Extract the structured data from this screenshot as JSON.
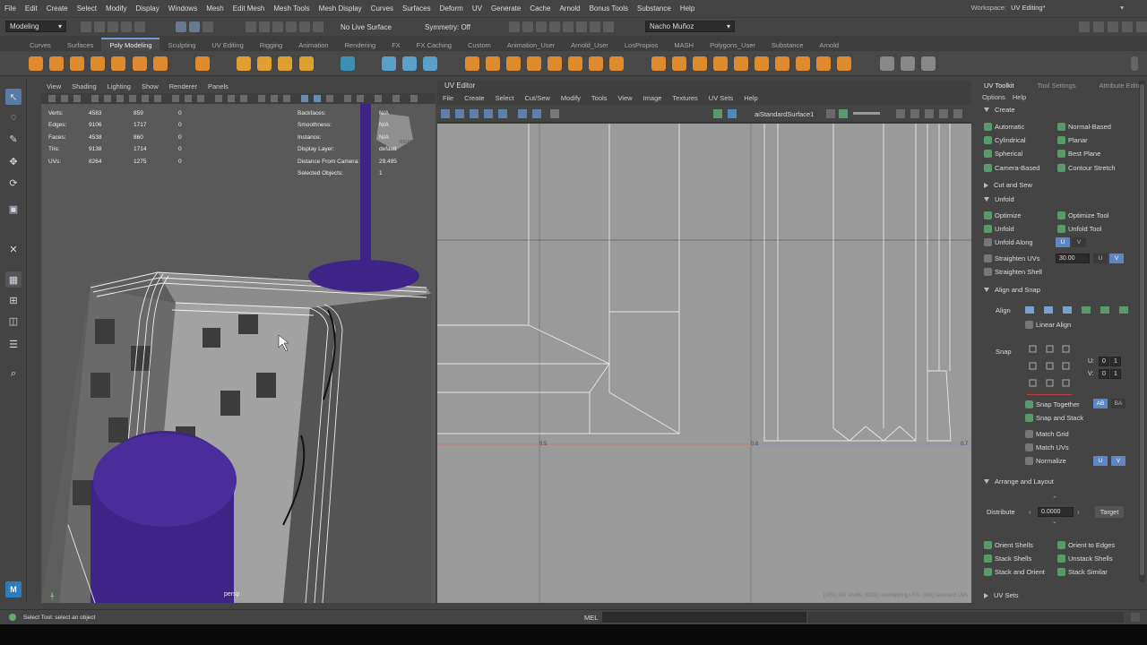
{
  "menubar": {
    "items": [
      "File",
      "Edit",
      "Create",
      "Select",
      "Modify",
      "Display",
      "Windows",
      "Mesh",
      "Edit Mesh",
      "Mesh Tools",
      "Mesh Display",
      "Curves",
      "Surfaces",
      "Deform",
      "UV",
      "Generate",
      "Cache",
      "Arnold",
      "Bonus Tools",
      "Substance",
      "Help"
    ],
    "workspace_label": "Workspace:",
    "workspace_value": "UV Editing*"
  },
  "statusline": {
    "mode": "Modeling",
    "live_surface": "No Live Surface",
    "symmetry": "Symmetry: Off",
    "user": "Nacho Muñoz"
  },
  "shelf": {
    "tabs": [
      "Curves",
      "Surfaces",
      "Poly Modeling",
      "Sculpting",
      "UV Editing",
      "Rigging",
      "Animation",
      "Rendering",
      "FX",
      "FX Caching",
      "Custom",
      "Animation_User",
      "Arnold_User",
      "LosPropios",
      "MASH",
      "Polygons_User",
      "Substance",
      "Arnold"
    ],
    "active_tab": "Poly Modeling"
  },
  "viewport": {
    "menu": [
      "View",
      "Shading",
      "Lighting",
      "Show",
      "Renderer",
      "Panels"
    ],
    "hud_left": [
      {
        "label": "Verts:",
        "a": "4583",
        "b": "859",
        "c": "0"
      },
      {
        "label": "Edges:",
        "a": "9106",
        "b": "1717",
        "c": "0"
      },
      {
        "label": "Faces:",
        "a": "4538",
        "b": "860",
        "c": "0"
      },
      {
        "label": "Tris:",
        "a": "9138",
        "b": "1714",
        "c": "0"
      },
      {
        "label": "UVs:",
        "a": "8264",
        "b": "1275",
        "c": "0"
      }
    ],
    "hud_right": [
      {
        "label": "Backfaces:",
        "value": "N/A"
      },
      {
        "label": "Smoothness:",
        "value": "N/A"
      },
      {
        "label": "Instance:",
        "value": "N/A"
      },
      {
        "label": "Display Layer:",
        "value": "default"
      },
      {
        "label": "Distance From Camera:",
        "value": "29.495"
      },
      {
        "label": "Selected Objects:",
        "value": "1"
      }
    ],
    "camera_label": "persp",
    "viewcube_label": "RIGHT"
  },
  "uv_editor": {
    "title": "UV Editor",
    "menu": [
      "File",
      "Create",
      "Select",
      "Cut/Sew",
      "Modify",
      "Tools",
      "View",
      "Image",
      "Textures",
      "UV Sets",
      "Help"
    ],
    "material": "aiStandardSurface1",
    "axis_labels": {
      "left": "0.5",
      "mid": "0.6",
      "right": "0.7"
    },
    "status": "(0/51) UV shells, (0/32) overlapping UVs, (0/8) reversed UVs"
  },
  "toolkit": {
    "tabs": [
      "UV Toolkit",
      "Tool Settings",
      "Attribute Editor"
    ],
    "submenu": [
      "Options",
      "Help"
    ],
    "create": {
      "title": "Create",
      "buttons": [
        "Automatic",
        "Normal-Based",
        "Cylindrical",
        "Planar",
        "Spherical",
        "Best Plane",
        "Camera-Based",
        "Contour Stretch"
      ]
    },
    "cut_and_sew": "Cut and Sew",
    "unfold": {
      "title": "Unfold",
      "buttons": [
        "Optimize",
        "Optimize Tool",
        "Unfold",
        "Unfold Tool"
      ],
      "unfold_along": "Unfold Along",
      "u": "U",
      "v": "V",
      "straighten_uvs": "Straighten UVs",
      "straighten_value": "30.00",
      "straighten_shell": "Straighten Shell"
    },
    "align_snap": {
      "title": "Align and Snap",
      "align": "Align",
      "linear_align": "Linear Align",
      "snap": "Snap",
      "u_label": "U:",
      "v_label": "V:",
      "u_vals": [
        "0",
        "1"
      ],
      "v_vals": [
        "0",
        "1"
      ],
      "snap_together": "Snap Together",
      "ab": "AB",
      "ba": "BA",
      "snap_and_stack": "Snap and Stack",
      "match_grid": "Match Grid",
      "match_uvs": "Match UVs",
      "normalize": "Normalize"
    },
    "arrange": {
      "title": "Arrange and Layout",
      "distribute": "Distribute",
      "distribute_value": "0.0000",
      "target": "Target",
      "buttons": [
        "Orient Shells",
        "Orient to Edges",
        "Stack Shells",
        "Unstack Shells",
        "Stack and Orient",
        "Stack Similar"
      ]
    },
    "uv_sets": "UV Sets"
  },
  "helpline": "Select Tool: select an object",
  "cmdline_lang": "MEL",
  "colors": {
    "accent": "#5f86c4",
    "purple": "#3e2486",
    "uvgrid": "#9a9a9a"
  }
}
